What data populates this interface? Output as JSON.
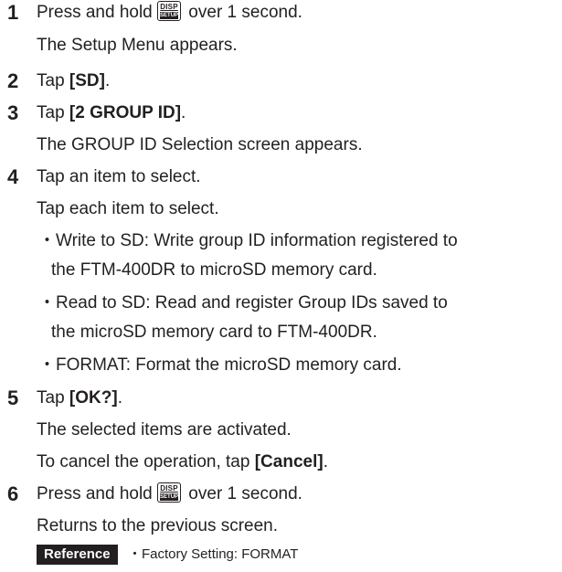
{
  "steps": [
    {
      "num": "1",
      "lines": {
        "a_pre": "Press and hold",
        "a_post": " over 1 second.",
        "b": "The Setup Menu appears."
      }
    },
    {
      "num": "2",
      "lines": {
        "a_pre": "Tap ",
        "a_bold": "[SD]",
        "a_post": "."
      }
    },
    {
      "num": "3",
      "lines": {
        "a_pre": "Tap ",
        "a_bold": "[2 GROUP ID]",
        "a_post": ".",
        "b": "The GROUP ID Selection screen appears."
      }
    },
    {
      "num": "4",
      "lines": {
        "a": "Tap an item to select.",
        "b": "Tap each item to select."
      },
      "bullets": [
        {
          "l1": "・Write to SD: Write group ID information registered to",
          "l2": "the FTM-400DR to microSD memory card."
        },
        {
          "l1": "・Read to SD: Read and register Group IDs saved to",
          "l2": "the microSD memory card to FTM-400DR."
        },
        {
          "l1": "・FORMAT: Format the microSD memory card."
        }
      ]
    },
    {
      "num": "5",
      "lines": {
        "a_pre": "Tap ",
        "a_bold": "[OK?]",
        "a_post": ".",
        "b": "The selected items are activated.",
        "c_pre": "To cancel the operation, tap ",
        "c_bold": "[Cancel]",
        "c_post": "."
      }
    },
    {
      "num": "6",
      "lines": {
        "a_pre": "Press and hold",
        "a_post": " over 1 second.",
        "b": "Returns to the previous screen."
      }
    }
  ],
  "key": {
    "top": "DISP",
    "bottom": "SETUP"
  },
  "reference": {
    "badge": "Reference",
    "text": "・Factory Setting: FORMAT"
  }
}
